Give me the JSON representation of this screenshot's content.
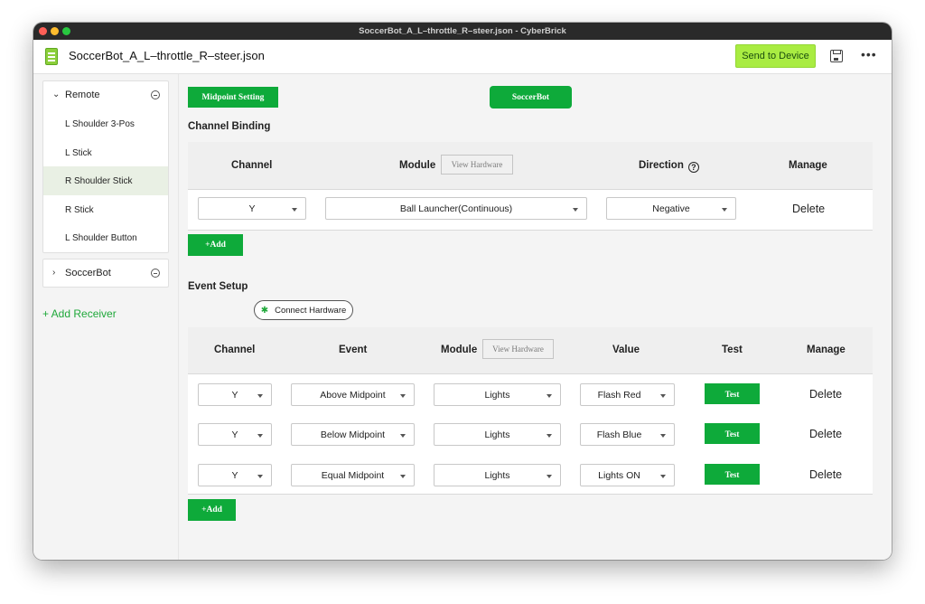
{
  "window": {
    "title": "SoccerBot_A_L–throttle_R–steer.json - CyberBrick"
  },
  "appbar": {
    "file_name": "SoccerBot_A_L–throttle_R–steer.json",
    "send_label": "Send to Device"
  },
  "sidebar": {
    "groups": [
      {
        "name": "Remote",
        "items": [
          "L Shoulder 3-Pos",
          "L Stick",
          "R Shoulder Stick",
          "R Stick",
          "L Shoulder Button"
        ]
      },
      {
        "name": "SoccerBot"
      }
    ],
    "add_receiver": "+ Add Receiver"
  },
  "toolbar": {
    "midpoint_label": "Midpoint Setting",
    "device_label": "SoccerBot"
  },
  "channel_binding": {
    "title": "Channel Binding",
    "headers": {
      "channel": "Channel",
      "module": "Module",
      "direction": "Direction",
      "manage": "Manage"
    },
    "view_hardware": "View Hardware",
    "row": {
      "channel": "Y",
      "module": "Ball Launcher(Continuous)",
      "direction": "Negative",
      "manage": "Delete"
    },
    "add_label": "+Add"
  },
  "event_setup": {
    "title": "Event Setup",
    "connect_label": "Connect Hardware",
    "headers": {
      "channel": "Channel",
      "event": "Event",
      "module": "Module",
      "value": "Value",
      "test": "Test",
      "manage": "Manage"
    },
    "view_hardware": "View Hardware",
    "rows": [
      {
        "channel": "Y",
        "event": "Above Midpoint",
        "module": "Lights",
        "value": "Flash Red",
        "test": "Test",
        "manage": "Delete"
      },
      {
        "channel": "Y",
        "event": "Below Midpoint",
        "module": "Lights",
        "value": "Flash Blue",
        "test": "Test",
        "manage": "Delete"
      },
      {
        "channel": "Y",
        "event": "Equal Midpoint",
        "module": "Lights",
        "value": "Lights ON",
        "test": "Test",
        "manage": "Delete"
      }
    ],
    "add_label": "+Add"
  },
  "colors": {
    "accent_green": "#0eaa3a",
    "send_button": "#a9ec42",
    "selected_item": "#e9f0e4"
  }
}
